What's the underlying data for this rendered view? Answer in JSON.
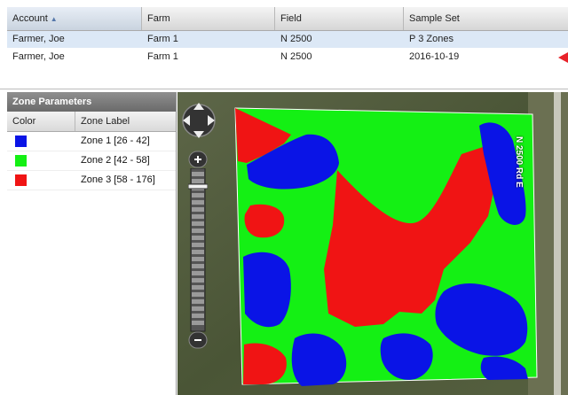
{
  "grid": {
    "columns": [
      "Account",
      "Farm",
      "Field",
      "Sample Set"
    ],
    "sort_indicator": "▲",
    "rows": [
      [
        "Farmer, Joe",
        "Farm 1",
        "N 2500",
        "P 3 Zones"
      ],
      [
        "Farmer, Joe",
        "Farm 1",
        "N 2500",
        "2016-10-19"
      ]
    ]
  },
  "zone_panel": {
    "title": "Zone Parameters",
    "col_color": "Color",
    "col_label": "Zone Label",
    "zones": [
      {
        "label": "Zone 1 [26 - 42]",
        "color": "#0a14e6"
      },
      {
        "label": "Zone 2 [42 - 58]",
        "color": "#14f014"
      },
      {
        "label": "Zone 3 [58 - 176]",
        "color": "#f01414"
      }
    ]
  },
  "map": {
    "road_label": "N 2500 Rd E",
    "colors": {
      "blue": "#0a14e6",
      "green": "#14f014",
      "red": "#f01414"
    }
  }
}
